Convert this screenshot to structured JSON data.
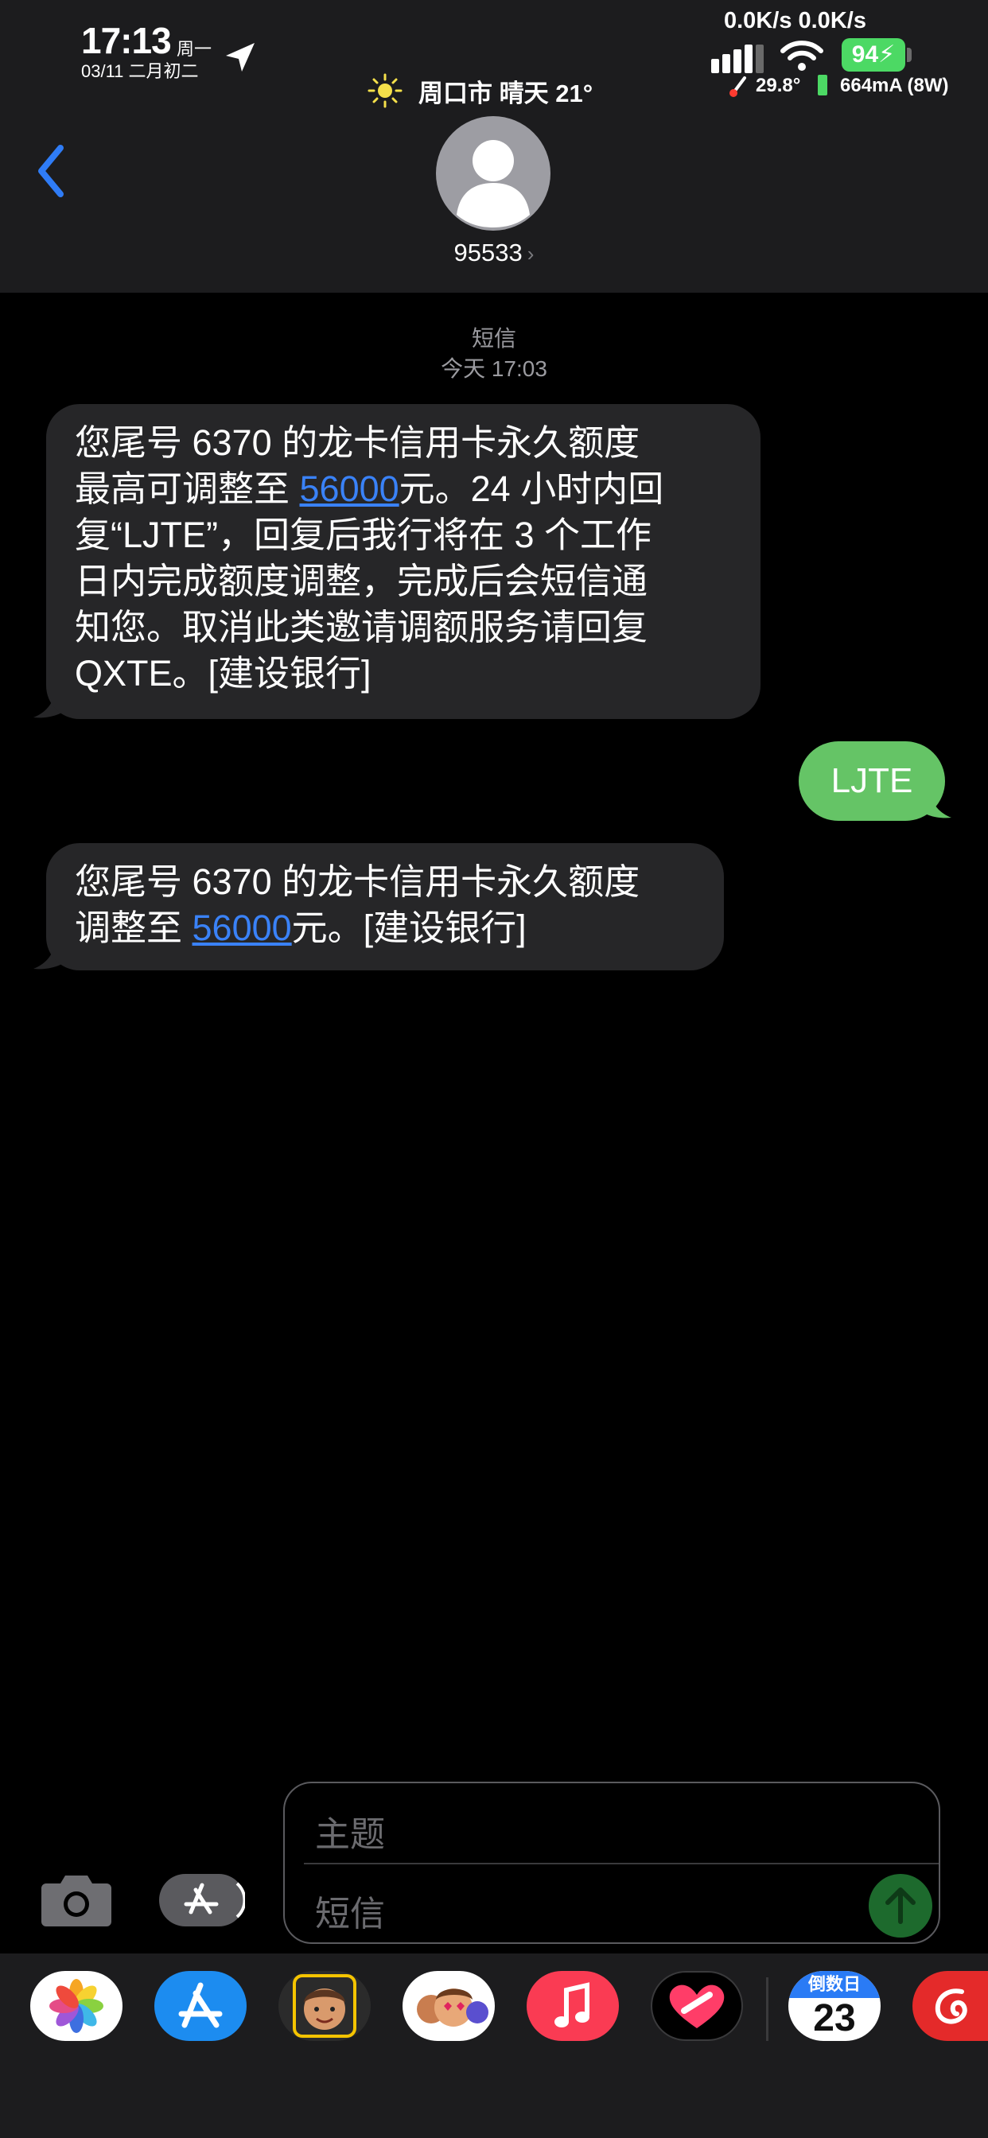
{
  "status_bar": {
    "time": "17:13",
    "weekday": "周一",
    "date": "03/11 二月初二",
    "net_speed": "0.0K/s 0.0K/s",
    "battery": "94",
    "temperature": "29.8°",
    "power": "664mA (8W)",
    "weather": "周口市 晴天 21°"
  },
  "header": {
    "contact": "95533",
    "chevron": "›"
  },
  "thread": {
    "service": "短信",
    "timestamp": "今天 17:03",
    "messages": [
      {
        "direction": "incoming",
        "parts": [
          "您尾号 6370 的龙卡信用卡永久额度",
          "最高可调整至 ",
          "56000",
          "元。24 小时内回",
          "复“LJTE”，回复后我行将在 3 个工作",
          "日内完成额度调整，完成后会短信通",
          "知您。取消此类邀请调额服务请回复",
          "QXTE。[建设银行]"
        ]
      },
      {
        "direction": "outgoing",
        "text": "LJTE"
      },
      {
        "direction": "incoming",
        "parts": [
          "您尾号 6370 的龙卡信用卡永久额度",
          "调整至 ",
          "56000",
          "元。[建设银行]"
        ]
      }
    ]
  },
  "composer": {
    "subject_placeholder": "主题",
    "message_placeholder": "短信"
  },
  "dock": {
    "apps": [
      "photos-icon",
      "app-store-icon",
      "memoji-icon",
      "memoji-stickers-icon",
      "music-icon",
      "fitness-icon",
      "countdown-icon",
      "netease-music-icon"
    ],
    "countdown_label": "倒数日",
    "countdown_number": "23"
  },
  "colors": {
    "incoming_bubble": "#262628",
    "outgoing_bubble": "#65c466",
    "link": "#3a82f7",
    "accent": "#2a7bf5"
  }
}
